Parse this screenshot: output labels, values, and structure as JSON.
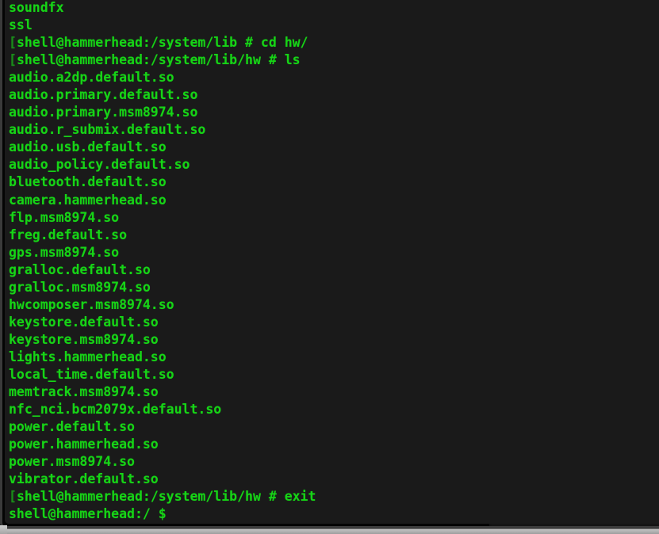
{
  "window": {
    "kind": "terminal-emulator",
    "shell_user": "shell",
    "host": "hammerhead",
    "background_color": "#1b1b1b",
    "foreground_color": "#16d416",
    "border_color": "#3a3a3a"
  },
  "terminal": {
    "lines": [
      {
        "type": "output",
        "text": "soundfx"
      },
      {
        "type": "output",
        "text": "ssl"
      },
      {
        "type": "prompt",
        "bracket": "[",
        "text": "shell@hammerhead:/system/lib # cd hw/"
      },
      {
        "type": "prompt",
        "bracket": "[",
        "text": "shell@hammerhead:/system/lib/hw # ls"
      },
      {
        "type": "output",
        "text": "audio.a2dp.default.so"
      },
      {
        "type": "output",
        "text": "audio.primary.default.so"
      },
      {
        "type": "output",
        "text": "audio.primary.msm8974.so"
      },
      {
        "type": "output",
        "text": "audio.r_submix.default.so"
      },
      {
        "type": "output",
        "text": "audio.usb.default.so"
      },
      {
        "type": "output",
        "text": "audio_policy.default.so"
      },
      {
        "type": "output",
        "text": "bluetooth.default.so"
      },
      {
        "type": "output",
        "text": "camera.hammerhead.so"
      },
      {
        "type": "output",
        "text": "flp.msm8974.so"
      },
      {
        "type": "output",
        "text": "freg.default.so"
      },
      {
        "type": "output",
        "text": "gps.msm8974.so"
      },
      {
        "type": "output",
        "text": "gralloc.default.so"
      },
      {
        "type": "output",
        "text": "gralloc.msm8974.so"
      },
      {
        "type": "output",
        "text": "hwcomposer.msm8974.so"
      },
      {
        "type": "output",
        "text": "keystore.default.so"
      },
      {
        "type": "output",
        "text": "keystore.msm8974.so"
      },
      {
        "type": "output",
        "text": "lights.hammerhead.so"
      },
      {
        "type": "output",
        "text": "local_time.default.so"
      },
      {
        "type": "output",
        "text": "memtrack.msm8974.so"
      },
      {
        "type": "output",
        "text": "nfc_nci.bcm2079x.default.so"
      },
      {
        "type": "output",
        "text": "power.default.so"
      },
      {
        "type": "output",
        "text": "power.hammerhead.so"
      },
      {
        "type": "output",
        "text": "power.msm8974.so"
      },
      {
        "type": "output",
        "text": "vibrator.default.so"
      },
      {
        "type": "prompt",
        "bracket": "[",
        "text": "shell@hammerhead:/system/lib/hw # exit"
      },
      {
        "type": "prompt",
        "bracket": "",
        "text": "shell@hammerhead:/ $"
      }
    ],
    "commands_issued": [
      "cd hw/",
      "ls",
      "exit"
    ],
    "current_directory": "/",
    "previous_directory": "/system/lib/hw"
  },
  "background": {
    "description": "dimmed file-manager window behind the terminal",
    "document_icon": "file-page-icon"
  }
}
